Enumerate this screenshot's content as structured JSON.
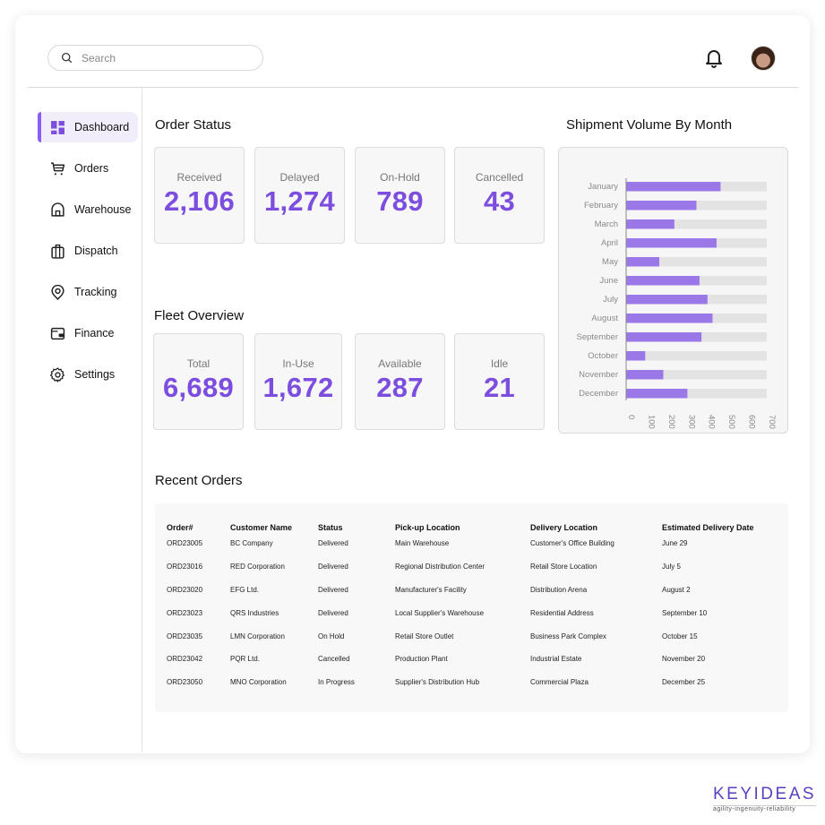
{
  "header": {
    "search_placeholder": "Search",
    "search_value": "",
    "notification_icon": "bell-icon",
    "avatar_icon": "user-avatar"
  },
  "sidebar": {
    "items": [
      {
        "label": "Dashboard",
        "icon": "dashboard-icon",
        "active": true
      },
      {
        "label": "Orders",
        "icon": "cart-icon",
        "active": false
      },
      {
        "label": "Warehouse",
        "icon": "warehouse-icon",
        "active": false
      },
      {
        "label": "Dispatch",
        "icon": "briefcase-icon",
        "active": false
      },
      {
        "label": "Tracking",
        "icon": "location-pin-icon",
        "active": false
      },
      {
        "label": "Finance",
        "icon": "wallet-icon",
        "active": false
      },
      {
        "label": "Settings",
        "icon": "gear-icon",
        "active": false
      }
    ]
  },
  "order_status": {
    "title": "Order Status",
    "cards": [
      {
        "label": "Received",
        "value": "2,106"
      },
      {
        "label": "Delayed",
        "value": "1,274"
      },
      {
        "label": "On-Hold",
        "value": "789"
      },
      {
        "label": "Cancelled",
        "value": "43"
      }
    ]
  },
  "fleet_overview": {
    "title": "Fleet Overview",
    "cards": [
      {
        "label": "Total",
        "value": "6,689"
      },
      {
        "label": "In-Use",
        "value": "1,672"
      },
      {
        "label": "Available",
        "value": "287"
      },
      {
        "label": "Idle",
        "value": "21"
      }
    ]
  },
  "chart_data": {
    "type": "bar",
    "orientation": "horizontal",
    "title": "Shipment Volume By Month",
    "xlabel": "",
    "ylabel": "",
    "categories": [
      "January",
      "February",
      "March",
      "April",
      "May",
      "June",
      "July",
      "August",
      "September",
      "October",
      "November",
      "December"
    ],
    "values": [
      470,
      350,
      240,
      450,
      165,
      365,
      405,
      430,
      375,
      95,
      185,
      305
    ],
    "xlim": [
      0,
      700
    ],
    "xticks": [
      0,
      100,
      200,
      300,
      400,
      500,
      600,
      700
    ],
    "grid": false,
    "legend": "none",
    "colors": {
      "bar": "#9b78e8",
      "track": "#e3e3e3"
    }
  },
  "recent_orders": {
    "title": "Recent Orders",
    "columns": [
      "Order#",
      "Customer Name",
      "Status",
      "Pick-up Location",
      "Delivery Location",
      "Estimated Delivery Date"
    ],
    "rows": [
      [
        "ORD23005",
        "BC Company",
        "Delivered",
        "Main Warehouse",
        "Customer's Office Building",
        "June 29"
      ],
      [
        "ORD23016",
        "RED Corporation",
        "Delivered",
        "Regional Distribution Center",
        "Retail Store Location",
        "July 5"
      ],
      [
        "ORD23020",
        "EFG Ltd.",
        "Delivered",
        "Manufacturer's Facility",
        "Distribution Arena",
        "August 2"
      ],
      [
        "ORD23023",
        "QRS Industries",
        "Delivered",
        "Local Supplier's Warehouse",
        "Residential Address",
        "September 10"
      ],
      [
        "ORD23035",
        "LMN Corporation",
        "On Hold",
        "Retail Store Outlet",
        "Business Park Complex",
        "October 15"
      ],
      [
        "ORD23042",
        "PQR Ltd.",
        "Cancelled",
        "Production Plant",
        "Industrial Estate",
        "November 20"
      ],
      [
        "ORD23050",
        "MNO Corporation",
        "In Progress",
        "Supplier's Distribution Hub",
        "Commercial Plaza",
        "December 25"
      ]
    ]
  },
  "branding": {
    "name": "KEYIDEAS",
    "tagline": "agility-ingenuity-reliability"
  },
  "colors": {
    "accent": "#7c4ddf",
    "active_bg": "#f1edfb",
    "card_bg": "#f7f7f7"
  }
}
